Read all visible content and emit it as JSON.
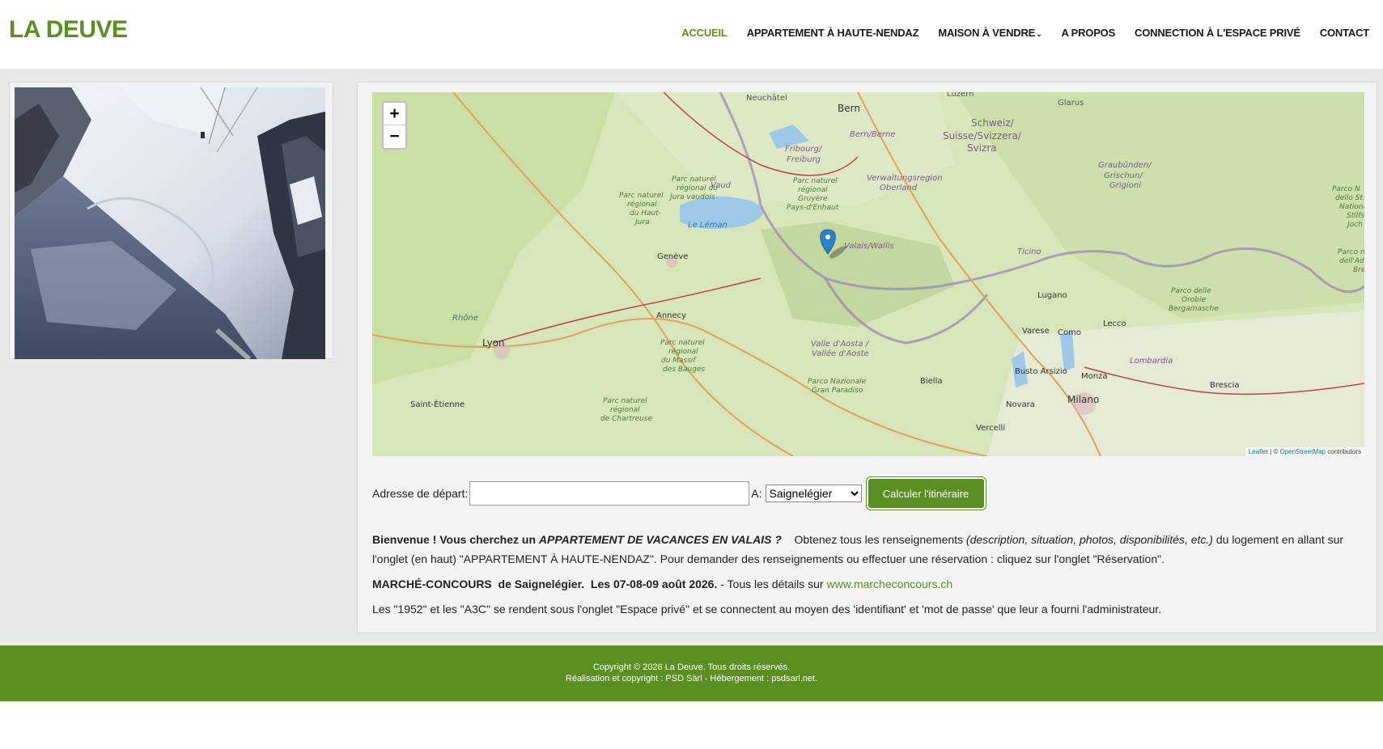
{
  "header": {
    "logo": "LA DEUVE",
    "nav": [
      {
        "label": "ACCUEIL",
        "active": true
      },
      {
        "label": "APPARTEMENT À HAUTE-NENDAZ"
      },
      {
        "label": "MAISON À VENDRE",
        "has_dropdown": true
      },
      {
        "label": "A PROPOS"
      },
      {
        "label": "CONNECTION À L'ESPACE PRIVÉ"
      },
      {
        "label": "CONTACT"
      }
    ]
  },
  "map": {
    "zoom_in": "+",
    "zoom_out": "−",
    "attribution_leaflet": "Leaflet",
    "attribution_osm": "OpenStreetMap",
    "attribution_suffix": "contributors",
    "labels": [
      "Neuchâtel",
      "Bern",
      "Bern/Berne",
      "Luzern",
      "Glarus",
      "Schweiz/",
      "Suisse/Svizzera/",
      "Svizra",
      "Fribourg/",
      "Freiburg",
      "Vaud",
      "Parc naturel",
      "régional",
      "Gruyère",
      "Pays-d'Enhaut",
      "Parc naturel",
      "régional du",
      "Jura vaudois",
      "Parc naturel",
      "régional",
      "du Haut-",
      "Jura",
      "Verwaltungsregion",
      "Oberland",
      "Graubünden/",
      "Grischun/",
      "Grigioni",
      "Le Léman",
      "Genève",
      "Valais/Wallis",
      "Ticino",
      "Parco N",
      "dello St",
      "Nationa",
      "Stilfs",
      "Joch",
      "Parco n",
      "dell'Ada",
      "Bre",
      "Annecy",
      "Rhône",
      "Lugano",
      "Parco delle",
      "Orobie",
      "Bergamasche",
      "Lecco",
      "Varese",
      "Como",
      "Lyon",
      "Valle d'Aosta /",
      "Vallée d'Aoste",
      "Parc naturel",
      "régional",
      "du Massif",
      "des Bauges",
      "Lombardia",
      "Parco Nazionale",
      "Gran Paradiso",
      "Biella",
      "Busto Arsizio",
      "Monza",
      "Brescia",
      "Saint-Étienne",
      "Parc naturel",
      "régional",
      "de Chartreuse",
      "Novara",
      "Milano",
      "Vercelli"
    ]
  },
  "route_form": {
    "start_label": "Adresse de départ:",
    "start_value": "",
    "to_label": "A:",
    "destination": "Saignelégier",
    "submit": "Calculer l'itinéraire"
  },
  "content": {
    "p1_bold": "Bienvenue ! Vous cherchez un ",
    "p1_bold_italic": "APPARTEMENT DE VACANCES EN VALAIS ?",
    "p1_text": "    Obtenez tous les renseignements ",
    "p1_italic": "(description, situation, photos, disponibilités, etc.)",
    "p1_rest": " du logement en allant sur l'onglet (en haut) \"APPARTEMENT À HAUTE-NENDAZ\". Pour demander des renseignements ou effectuer une réservation : cliquez sur l'onglet \"Réservation\".",
    "p2_bold": "MARCHÉ-CONCOURS  de Saignelégier.  Les 07-08-09 août 2026.",
    "p2_text": " - Tous les détails sur ",
    "p2_link": "www.marcheconcours.ch",
    "p3": "Les \"1952\" et les \"A3C\" se rendent sous l'onglet \"Espace privé\" et se connectent au moyen des 'identifiant' et 'mot de passe' que leur a fourni l'administrateur."
  },
  "footer": {
    "line1": "Copyright © 2026 La Deuve. Tous droits réservés.",
    "line2": "Réalisation et copyright : PSD Sàrl - Hébergement : psdsarl.net."
  },
  "colors": {
    "brand_green": "#5a8f22",
    "background_gray": "#e8e8e8"
  }
}
